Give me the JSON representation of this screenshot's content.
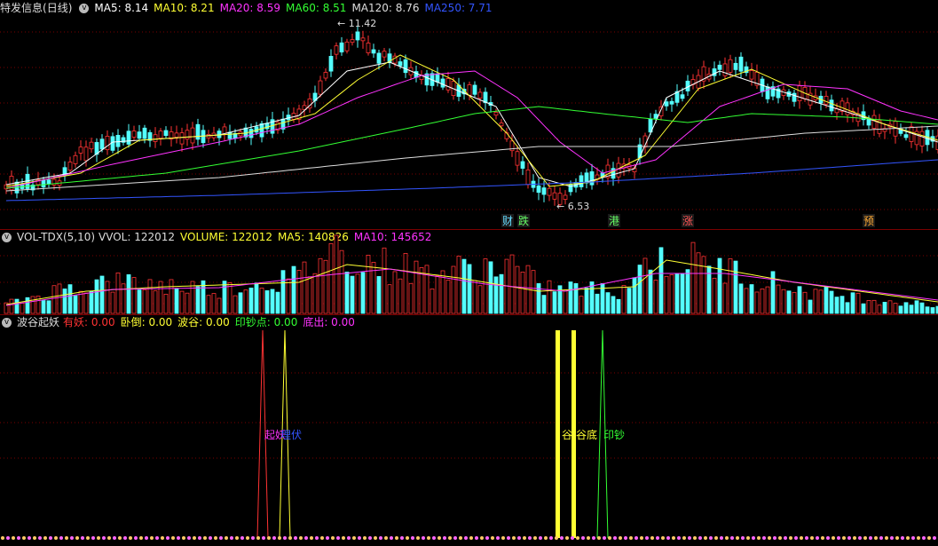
{
  "main": {
    "stock_name": "特发信息",
    "period": "(日线)",
    "toggle_symbol": "v",
    "ma": [
      {
        "label": "MA5: 8.14",
        "color": "#ffffff"
      },
      {
        "label": "MA10: 8.21",
        "color": "#ffff33"
      },
      {
        "label": "MA20: 8.59",
        "color": "#ff33ff"
      },
      {
        "label": "MA60: 8.51",
        "color": "#33ff33"
      },
      {
        "label": "MA120: 8.76",
        "color": "#dddddd"
      },
      {
        "label": "MA250: 7.71",
        "color": "#3355ff"
      }
    ],
    "high_label": "11.42",
    "low_label": "6.53",
    "events": [
      {
        "text": "财",
        "color": "#66ddff"
      },
      {
        "text": "跌",
        "color": "#66ff66"
      },
      {
        "text": "港",
        "color": "#66ff66"
      },
      {
        "text": "涨",
        "color": "#ff5555"
      },
      {
        "text": "预",
        "color": "#ffaa33"
      }
    ]
  },
  "volume": {
    "indicator": "VOL-TDX(5,10)",
    "items": [
      {
        "label": "VVOL: 122012",
        "color": "#dddddd"
      },
      {
        "label": "VOLUME: 122012",
        "color": "#ffff33"
      },
      {
        "label": "MA5: 140826",
        "color": "#ffff33"
      },
      {
        "label": "MA10: 145652",
        "color": "#ff33ff"
      }
    ]
  },
  "wave": {
    "indicator": "波谷起妖",
    "items": [
      {
        "label": "有妖: 0.00",
        "color": "#ff3333"
      },
      {
        "label": "卧倒: 0.00",
        "color": "#ffff33"
      },
      {
        "label": "波谷: 0.00",
        "color": "#ffff33"
      },
      {
        "label": "印钞点: 0.00",
        "color": "#33ff33"
      },
      {
        "label": "底出: 0.00",
        "color": "#ff33ff"
      }
    ],
    "annotations": [
      {
        "text": "起妖",
        "color": "#ff33ff"
      },
      {
        "text": "埋伏",
        "color": "#3355ff"
      },
      {
        "text": "谷",
        "color": "#ffff33"
      },
      {
        "text": "谷底",
        "color": "#ffff33"
      },
      {
        "text": "印钞",
        "color": "#33ff33"
      }
    ]
  },
  "colors": {
    "up": "#ff3333",
    "down": "#54ffff",
    "grid": "#7a0000",
    "bg": "#000000"
  }
}
